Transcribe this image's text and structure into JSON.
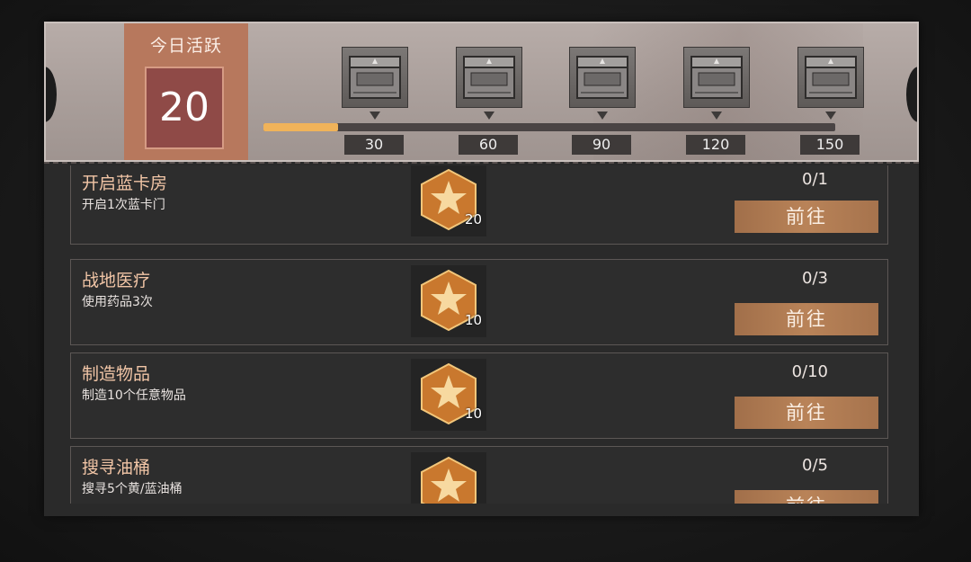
{
  "header": {
    "activity_title": "今日活跃",
    "activity_value": "20",
    "progress_fraction": 0.13,
    "milestones": [
      {
        "label": "30",
        "icon": "chest-icon"
      },
      {
        "label": "60",
        "icon": "chest-icon"
      },
      {
        "label": "90",
        "icon": "chest-icon"
      },
      {
        "label": "120",
        "icon": "chest-icon"
      },
      {
        "label": "150",
        "icon": "chest-icon"
      }
    ]
  },
  "tasks": [
    {
      "title": "开启蓝卡房",
      "desc": "开启1次蓝卡门",
      "reward": "20",
      "progress": "0/1",
      "button": "前往",
      "reward_icon": "star-medal-icon"
    },
    {
      "title": "战地医疗",
      "desc": "使用药品3次",
      "reward": "10",
      "progress": "0/3",
      "button": "前往",
      "reward_icon": "star-medal-icon"
    },
    {
      "title": "制造物品",
      "desc": "制造10个任意物品",
      "reward": "10",
      "progress": "0/10",
      "button": "前往",
      "reward_icon": "star-medal-icon"
    },
    {
      "title": "搜寻油桶",
      "desc": "搜寻5个黄/蓝油桶",
      "reward": "",
      "progress": "0/5",
      "button": "前往",
      "reward_icon": "star-medal-icon"
    }
  ],
  "colors": {
    "accent_gold": "#f0b35a",
    "button": "#b07a52",
    "activity_box": "#b7785d",
    "title_text": "#f1c5a6"
  }
}
